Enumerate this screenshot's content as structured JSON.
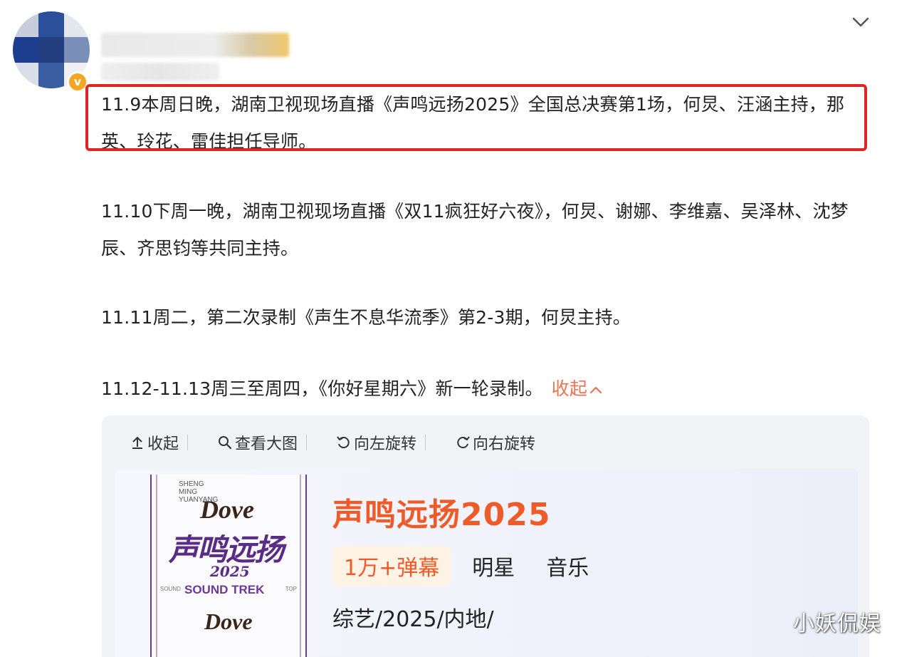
{
  "post": {
    "author_name_blurred": true,
    "verified_badge": "v",
    "paragraphs": [
      "11.9本周日晚，湖南卫视现场直播《声鸣远扬2025》全国总决赛第1场，何炅、汪涵主持，那英、玲花、雷佳担任导师。",
      "11.10下周一晚，湖南卫视现场直播《双11疯狂好六夜》，何炅、谢娜、李维嘉、吴泽林、沈梦辰、齐思钧等共同主持。",
      "11.11周二，第二次录制《声生不息华流季》第2-3期，何炅主持。",
      "11.12-11.13周三至周四，《你好星期六》新一轮录制。"
    ],
    "collapse_label": "收起",
    "highlight_color": "#e02424",
    "link_color": "#eb7350"
  },
  "image_toolbar": {
    "collapse": "收起",
    "view_large": "查看大图",
    "rotate_left": "向左旋转",
    "rotate_right": "向右旋转"
  },
  "poster": {
    "small_text": [
      "SHENG",
      "MING",
      "YUANYANG"
    ],
    "brand": "Dove",
    "title_cn": "声鸣远扬",
    "year": "2025",
    "subtitle": "SOUND TREK",
    "side_left": "SOUND",
    "side_right": "TOP",
    "brand_bottom": "Dove"
  },
  "show_card": {
    "title": "声鸣远扬2025",
    "tags": [
      "1万+弹幕",
      "明星",
      "音乐"
    ],
    "info": "综艺/2025/内地/",
    "title_color": "#ee5a28"
  },
  "watermark": "小妖侃娱"
}
